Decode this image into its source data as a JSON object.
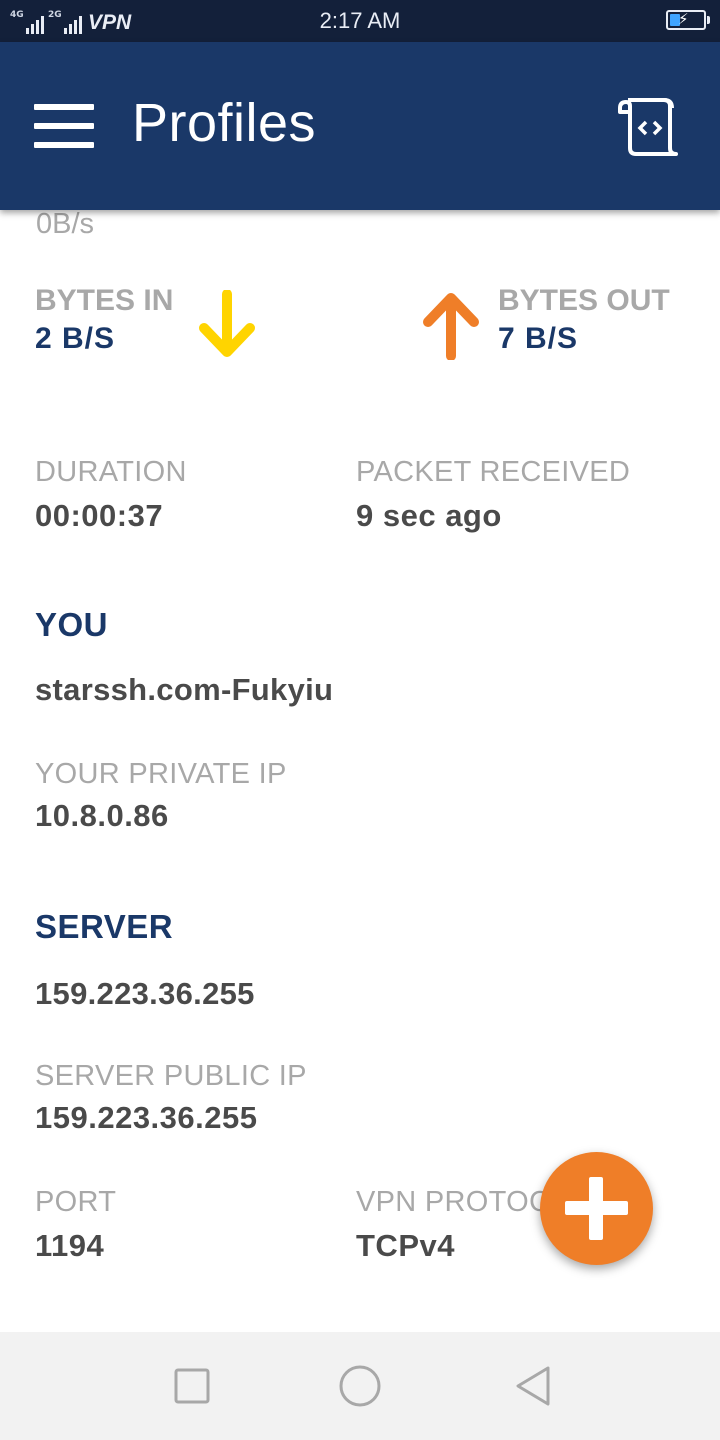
{
  "status_bar": {
    "signal_1": "4G",
    "signal_2": "2G",
    "vpn_label": "VPN",
    "time": "2:17 AM",
    "battery_level": 0.28,
    "charging": true
  },
  "app_bar": {
    "title": "Profiles",
    "menu_icon": "hamburger-menu-icon",
    "log_icon": "log-scroll-icon"
  },
  "traffic": {
    "rate_partial": "0B/s",
    "bytes_in_label": "BYTES IN",
    "bytes_in_value": "2 B/S",
    "bytes_out_label": "BYTES OUT",
    "bytes_out_value": "7 B/S",
    "in_arrow_color": "#ffd400",
    "out_arrow_color": "#ef7e28"
  },
  "stats": {
    "duration_label": "DURATION",
    "duration_value": "00:00:37",
    "packet_label": "PACKET RECEIVED",
    "packet_value": "9 sec ago"
  },
  "you": {
    "heading": "YOU",
    "profile_name": "starssh.com-Fukyiu",
    "private_ip_label": "YOUR PRIVATE IP",
    "private_ip_value": "10.8.0.86"
  },
  "server": {
    "heading": "SERVER",
    "address": "159.223.36.255",
    "public_ip_label": "SERVER PUBLIC IP",
    "public_ip_value": "159.223.36.255",
    "port_label": "PORT",
    "port_value": "1194",
    "protocol_label": "VPN PROTOCOL",
    "protocol_value": "TCPv4"
  },
  "fab": {
    "icon": "plus-icon",
    "color": "#ef7e28"
  },
  "nav": {
    "recents_icon": "square-recents-icon",
    "home_icon": "circle-home-icon",
    "back_icon": "triangle-back-icon"
  }
}
